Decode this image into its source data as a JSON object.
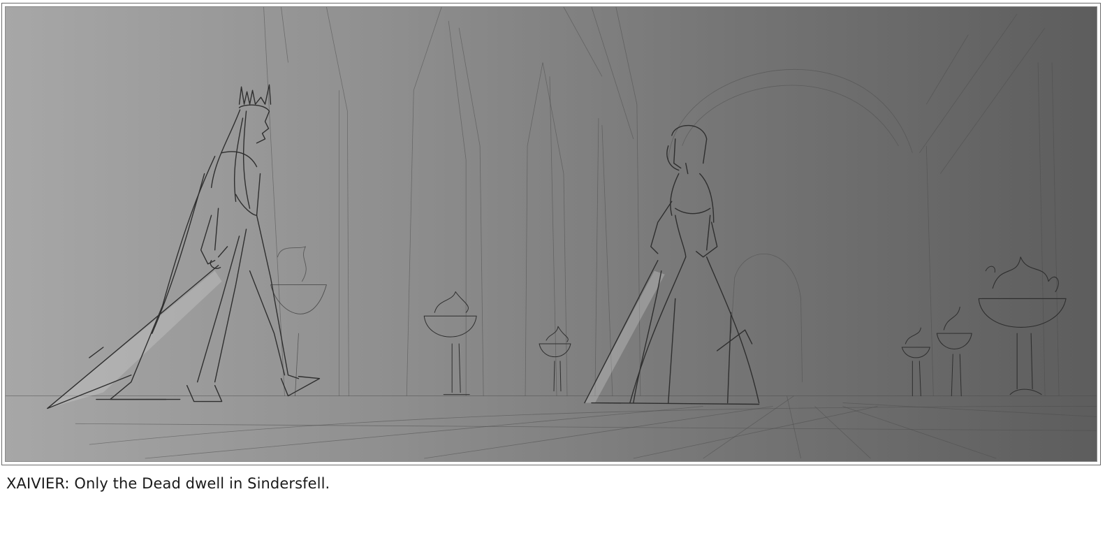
{
  "panel": {
    "image_description": "storyboard-sketch"
  },
  "caption": {
    "text": "XAIVIER: Only the Dead dwell in Sindersfell."
  }
}
